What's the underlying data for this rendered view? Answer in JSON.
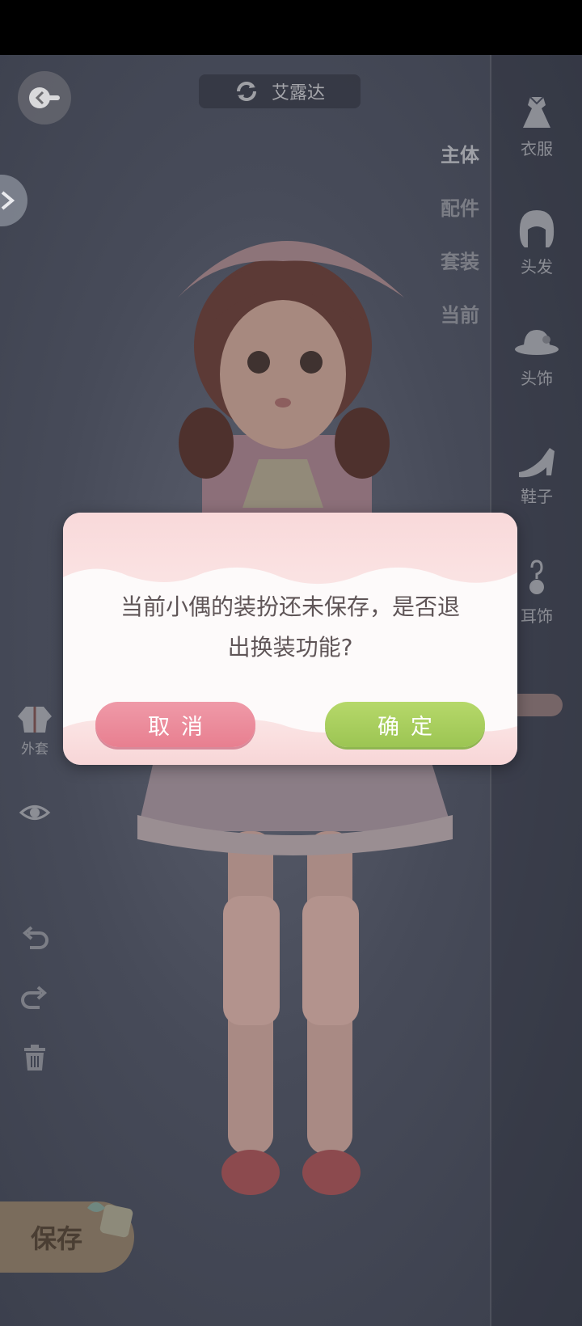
{
  "header": {
    "character_name": "艾露达",
    "refresh_icon": "refresh-icon",
    "back_icon": "back-arrow-icon"
  },
  "tabs": [
    "主体",
    "配件",
    "套装",
    "当前"
  ],
  "categories": [
    {
      "label": "衣服",
      "icon": "dress-icon"
    },
    {
      "label": "头发",
      "icon": "hair-icon"
    },
    {
      "label": "头饰",
      "icon": "hat-icon"
    },
    {
      "label": "鞋子",
      "icon": "shoe-icon"
    },
    {
      "label": "耳饰",
      "icon": "earring-icon"
    }
  ],
  "left_tools": {
    "coat_label": "外套",
    "icons": [
      "coat-icon",
      "eye-icon",
      "undo-icon",
      "redo-icon",
      "trash-icon"
    ]
  },
  "save_label": "保存",
  "dialog": {
    "message_line1": "当前小偶的装扮还未保存，是否退",
    "message_line2": "出换装功能?",
    "cancel_label": "取消",
    "confirm_label": "确定"
  },
  "colors": {
    "cancel": "#e87f90",
    "confirm": "#9cc553",
    "dialog_bg": "#fdfafa"
  }
}
